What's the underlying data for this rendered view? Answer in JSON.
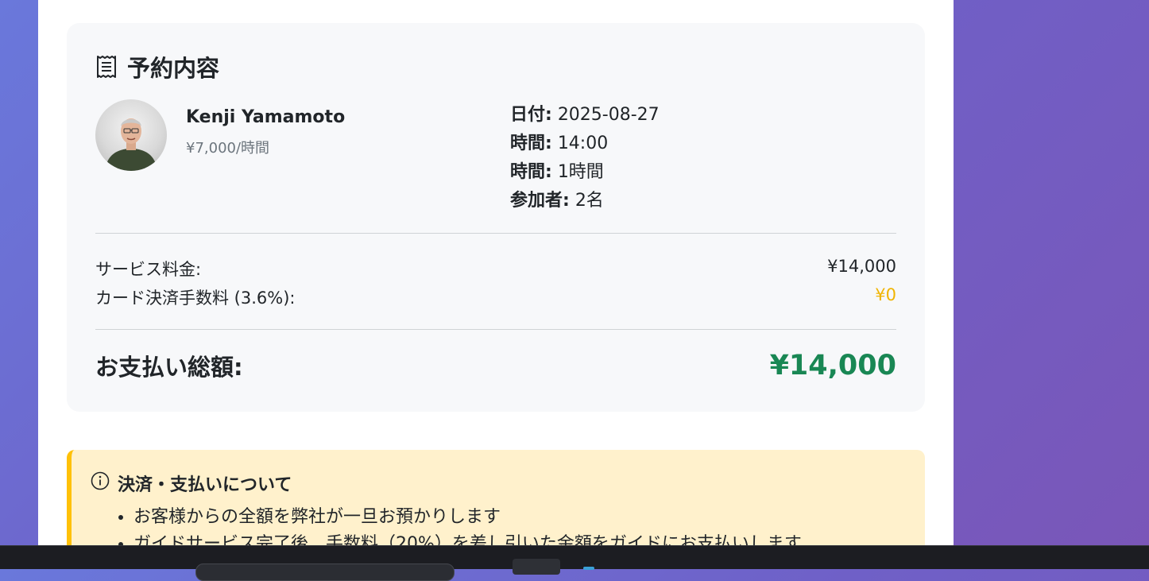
{
  "summary": {
    "title": "予約内容",
    "title_icon": "receipt-icon",
    "guide": {
      "name": "Kenji Yamamoto",
      "rate": "¥7,000/時間",
      "avatar": "guide-avatar"
    },
    "details": [
      {
        "label": "日付:",
        "value": "2025-08-27"
      },
      {
        "label": "時間:",
        "value": "14:00"
      },
      {
        "label": "時間:",
        "value": "1時間"
      },
      {
        "label": "参加者:",
        "value": "2名"
      }
    ],
    "fees": {
      "service_label": "サービス料金:",
      "service_amount": "¥14,000",
      "card_label": "カード決済手数料 (3.6%):",
      "card_amount": "¥0"
    },
    "total": {
      "label": "お支払い総額:",
      "amount": "¥14,000"
    }
  },
  "notice": {
    "icon": "info-circle-icon",
    "title": "決済・支払いについて",
    "items": [
      "お客様からの全額を弊社が一旦お預かりします",
      "ガイドサービス完了後、手数料（20%）を差し引いた金額をガイドにお支払いします"
    ]
  },
  "colors": {
    "total_green": "#198754",
    "fee_zero_yellow": "#f0b400",
    "notice_border": "#ffc107",
    "notice_bg": "#fff1cc"
  }
}
